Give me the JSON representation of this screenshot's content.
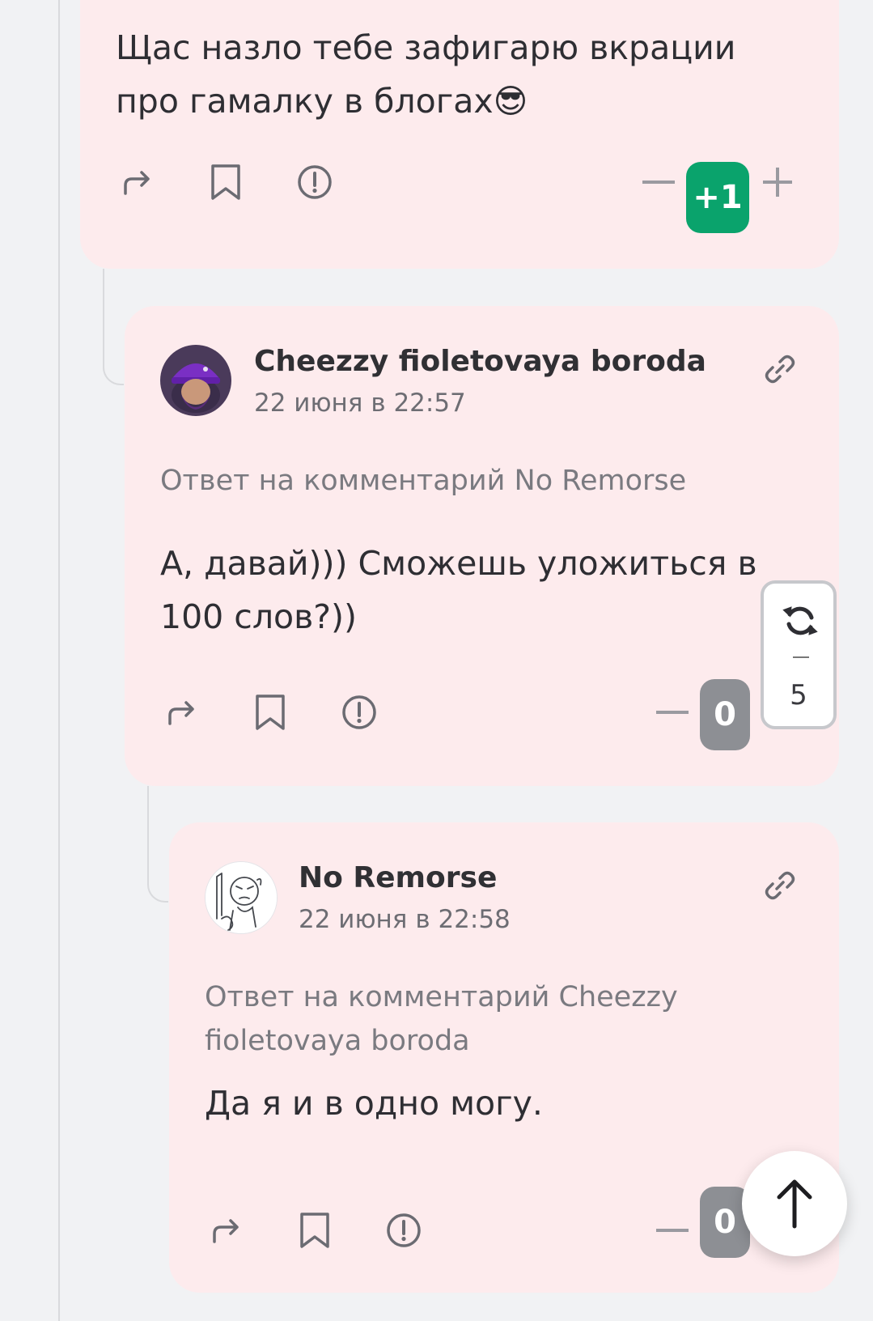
{
  "comments": [
    {
      "text": "Щас назло тебе зафигарю вкрации про гамалку в блогах😎",
      "score": "+1",
      "actions": [
        "share-icon",
        "bookmark-icon",
        "report-icon"
      ]
    },
    {
      "author": "Cheezzy fioletovaya boroda",
      "date": "22 июня в 22:57",
      "reply_to": "Ответ на комментарий No Remorse",
      "text": "А, давай))) Сможешь уложиться в 100 слов?))",
      "score": "0"
    },
    {
      "author": "No Remorse",
      "date": "22 июня в 22:58",
      "reply_to": "Ответ на комментарий Cheezzy fioletovaya boroda",
      "text": "Да я и в одно могу.",
      "score": "0"
    }
  ],
  "refresh_widget": {
    "count": "5",
    "icon": "refresh-icon"
  },
  "scroll_top": {
    "icon": "arrow-up-icon"
  },
  "colors": {
    "card_background": "#fdebed",
    "page_background": "#f1f2f4",
    "positive_score": "#0aa36c",
    "neutral_score": "#8d8f94"
  }
}
